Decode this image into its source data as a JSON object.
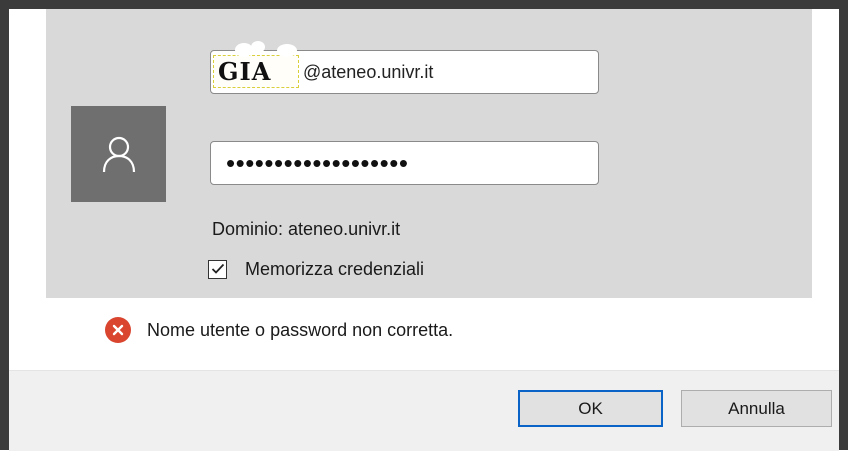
{
  "login": {
    "username_prefix": "GIA",
    "username_domain": "@ateneo.univr.it",
    "password_masked": "•••••••••••••••••••",
    "domain_text": "Dominio: ateneo.univr.it",
    "remember_label": "Memorizza credenziali",
    "remember_checked": true
  },
  "error": {
    "message": "Nome utente o password non corretta."
  },
  "buttons": {
    "ok_label": "OK",
    "cancel_label": "Annulla"
  },
  "icons": {
    "avatar": "user-icon",
    "error": "error-icon",
    "checkbox": "checkmark-icon"
  },
  "colors": {
    "panel_bg": "#d9d9d9",
    "avatar_bg": "#6f6f6f",
    "error_red": "#d9452f",
    "focus_blue": "#0a64c8"
  }
}
